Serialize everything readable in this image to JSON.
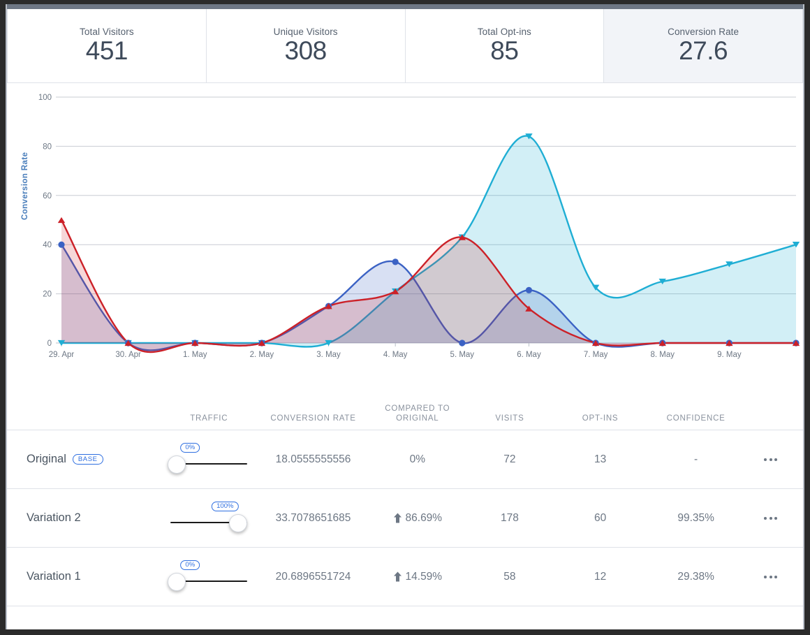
{
  "kpis": [
    {
      "label": "Total Visitors",
      "value": "451",
      "selected": false
    },
    {
      "label": "Unique Visitors",
      "value": "308",
      "selected": false
    },
    {
      "label": "Total Opt-ins",
      "value": "85",
      "selected": false
    },
    {
      "label": "Conversion Rate",
      "value": "27.6",
      "selected": true
    }
  ],
  "table": {
    "headers": {
      "name": "",
      "traffic": "TRAFFIC",
      "conversion_rate": "CONVERSION RATE",
      "compared_line1": "COMPARED TO",
      "compared_line2": "ORIGINAL",
      "visits": "VISITS",
      "optins": "OPT-INS",
      "confidence": "CONFIDENCE"
    },
    "rows": [
      {
        "name": "Original",
        "badge": "BASE",
        "traffic": "0%",
        "traffic_pct": 0,
        "conversion_rate": "18.0555555556",
        "compared": "0%",
        "compared_arrow": false,
        "visits": "72",
        "optins": "13",
        "confidence": "-"
      },
      {
        "name": "Variation 2",
        "badge": "",
        "traffic": "100%",
        "traffic_pct": 100,
        "conversion_rate": "33.7078651685",
        "compared": "86.69%",
        "compared_arrow": true,
        "visits": "178",
        "optins": "60",
        "confidence": "99.35%"
      },
      {
        "name": "Variation 1",
        "badge": "",
        "traffic": "0%",
        "traffic_pct": 0,
        "conversion_rate": "20.6896551724",
        "compared": "14.59%",
        "compared_arrow": true,
        "visits": "58",
        "optins": "12",
        "confidence": "29.38%"
      }
    ]
  },
  "chart_data": {
    "type": "line",
    "title": "",
    "xlabel": "",
    "ylabel": "Conversion Rate",
    "ylim": [
      0,
      100
    ],
    "yticks": [
      0,
      20,
      40,
      60,
      80,
      100
    ],
    "grid": true,
    "legend": "none",
    "categories": [
      "29. Apr",
      "30. Apr",
      "1. May",
      "2. May",
      "3. May",
      "4. May",
      "5. May",
      "6. May",
      "7. May",
      "8. May",
      "9. May",
      ""
    ],
    "series": [
      {
        "name": "Original",
        "color": "#cc2128",
        "fill": "rgba(204,33,40,0.18)",
        "marker": "triangle-up",
        "values": [
          50,
          0,
          0,
          0,
          15,
          21,
          43,
          14,
          0,
          0,
          0,
          0
        ]
      },
      {
        "name": "Variation 1",
        "color": "#3b62c4",
        "fill": "rgba(59,98,196,0.20)",
        "marker": "circle",
        "values": [
          40,
          0,
          0,
          0,
          15,
          33,
          0,
          21.5,
          0,
          0,
          0,
          0
        ]
      },
      {
        "name": "Variation 2",
        "color": "#1faed4",
        "fill": "rgba(31,174,212,0.20)",
        "marker": "triangle-down",
        "values": [
          0,
          0,
          0,
          0,
          0,
          21,
          43,
          84,
          22.5,
          25,
          32,
          40
        ]
      }
    ]
  }
}
